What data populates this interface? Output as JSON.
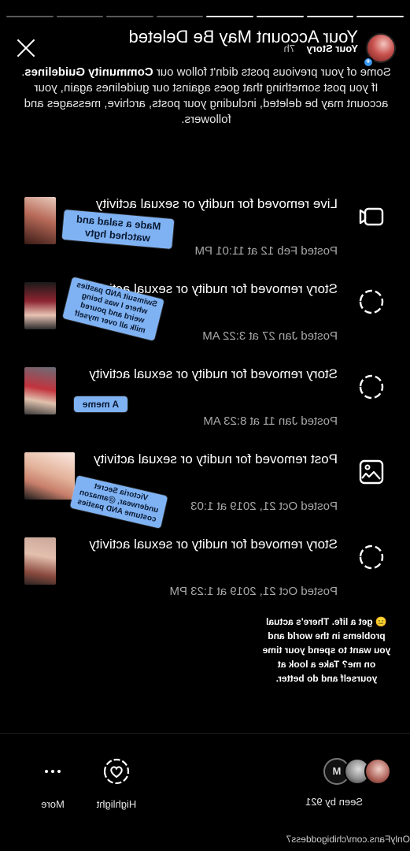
{
  "app": {
    "mirrored": true
  },
  "progress": {
    "segments": 8,
    "completed": 4
  },
  "header": {
    "story_label": "Your Story",
    "story_age": "7h",
    "title": "Your Account May Be Deleted",
    "intro_part1": "Some of your previous posts didn't follow our ",
    "intro_bold": "Community Guidelines",
    "intro_part2": ". If you post something that goes against our guidelines again, your account may be deleted, including your posts, archive, messages and followers."
  },
  "violations": [
    {
      "kind": "live",
      "heading": "Live removed for nudity or sexual activity",
      "posted": "Posted Feb 12 at 11:01 PM",
      "sticker": "Made a salad and watched hgtv"
    },
    {
      "kind": "story",
      "heading": "Story removed for nudity or sexual activity",
      "posted": "Posted Jan 27 at 3:22 AM",
      "sticker": "Swimsuit AND pasties where I was being weird and poured milk all over myself"
    },
    {
      "kind": "story",
      "heading": "Story removed for nudity or sexual activity",
      "posted": "Posted Jan 11 at 8:23 AM",
      "sticker": "A meme"
    },
    {
      "kind": "post",
      "heading": "Post removed for nudity or sexual activity",
      "posted": "Posted Oct 21, 2019 at 1:03",
      "sticker": "Victoria Secret underwear, @amazon costume AND pasties"
    },
    {
      "kind": "story",
      "heading": "Story removed for nudity or sexual activity",
      "posted": "Posted Oct 21, 2019 at 1:23 PM",
      "sticker": ""
    }
  ],
  "rant": "😑 get a life. There's actual problems in the world and you want to spend your time on me? Take a look at yourself and do better.",
  "bottom": {
    "seen_label": "Seen by 921",
    "highlight_label": "Highlight",
    "more_label": "More"
  },
  "watermark": "OnlyFans.com/chibigoddess7",
  "colors": {
    "background": "#000000",
    "sticker": "#7fb2f3",
    "accent": "#3897f0",
    "muted_text": "#a8a8a8"
  },
  "icons": {
    "close": "close-icon",
    "live": "live-camera-icon",
    "story": "story-ring-icon",
    "post": "image-icon",
    "highlight": "heart-circle-icon",
    "more": "more-dots-icon"
  }
}
